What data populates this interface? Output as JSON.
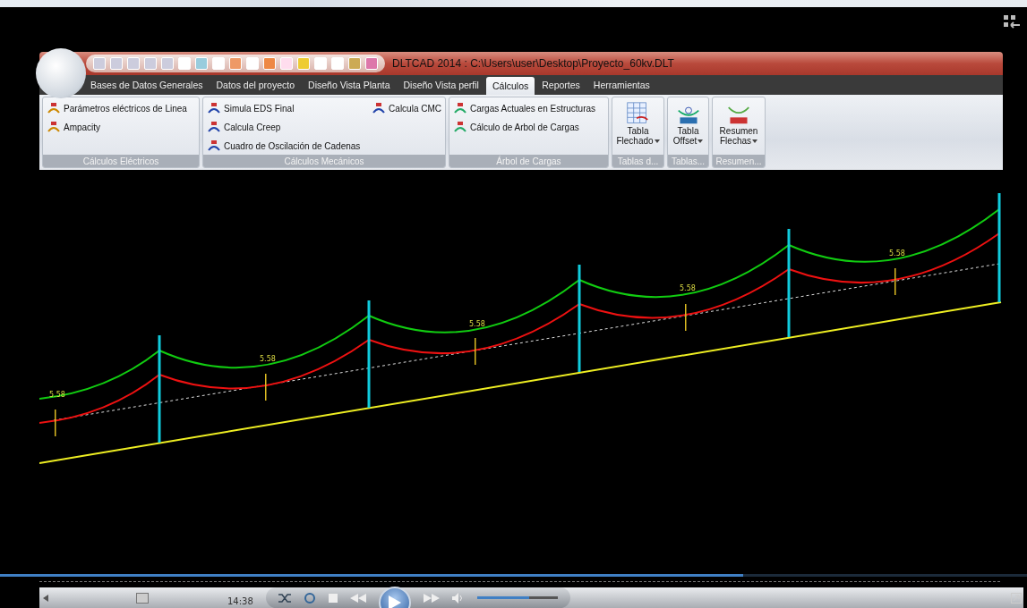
{
  "window": {
    "title": "DLTCAD 2014 : C:\\Users\\user\\Desktop\\Proyecto_60kv.DLT"
  },
  "tabs": [
    {
      "label": "Bases de Datos Generales",
      "selected": false
    },
    {
      "label": "Datos del proyecto",
      "selected": false
    },
    {
      "label": "Diseño Vista Planta",
      "selected": false
    },
    {
      "label": "Diseño Vista perfil",
      "selected": false
    },
    {
      "label": "Cálculos",
      "selected": true
    },
    {
      "label": "Reportes",
      "selected": false
    },
    {
      "label": "Herramientas",
      "selected": false
    }
  ],
  "ribbon_groups": [
    {
      "title": "Cálculos Eléctricos",
      "kind": "small",
      "columns": [
        [
          {
            "label": "Parámetros eléctricos de Linea"
          },
          {
            "label": "Ampacity"
          }
        ]
      ]
    },
    {
      "title": "Cálculos Mecánicos",
      "kind": "small",
      "columns": [
        [
          {
            "label": "Simula EDS Final"
          },
          {
            "label": "Calcula Creep"
          },
          {
            "label": "Cuadro de Oscilación de Cadenas"
          }
        ],
        [
          {
            "label": "Calcula CMC"
          }
        ]
      ]
    },
    {
      "title": "Árbol de Cargas",
      "kind": "small",
      "columns": [
        [
          {
            "label": "Cargas Actuales en Estructuras"
          },
          {
            "label": "Cálculo de Arbol de Cargas"
          }
        ]
      ]
    },
    {
      "title": "Tablas d...",
      "kind": "large",
      "buttons": [
        {
          "label_lines": [
            "Tabla",
            "Flechado"
          ],
          "dropdown": true
        }
      ]
    },
    {
      "title": "Tablas...",
      "kind": "large",
      "buttons": [
        {
          "label_lines": [
            "Tabla",
            "Offset"
          ],
          "dropdown": true
        }
      ]
    },
    {
      "title": "Resumen...",
      "kind": "large",
      "buttons": [
        {
          "label_lines": [
            "Resumen",
            "Flechas"
          ],
          "dropdown": true
        }
      ]
    }
  ],
  "profile": {
    "sag_labels": [
      "5.58",
      "5.58",
      "5.58",
      "5.58",
      "5.58"
    ]
  },
  "player": {
    "level": 0.724,
    "time": "14:38",
    "volume": {
      "level": 0.65
    }
  }
}
